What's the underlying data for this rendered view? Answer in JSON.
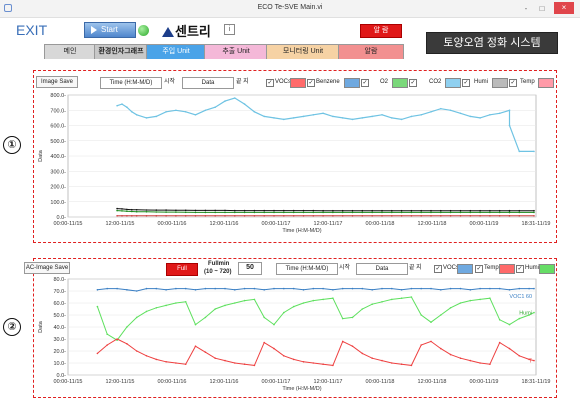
{
  "window": {
    "title": "ECO Te-SVE Main.vi",
    "minimize": "-",
    "maximize": "□",
    "close": "×"
  },
  "toolbar": {
    "exit_label": "EXIT",
    "start_label": "Start",
    "logo_text": "센트리",
    "info_icon": "i",
    "alarm_label": "알 람",
    "system_title": "토양오염 정화 시스템"
  },
  "tabs": [
    {
      "label": "메인",
      "color": "#d8d8d8"
    },
    {
      "label": "환경인자그래프",
      "color": "#c8c8c8"
    },
    {
      "label": "주입 Unit",
      "color": "#4aa3e8"
    },
    {
      "label": "추출 Unit",
      "color": "#f4b8d8"
    },
    {
      "label": "모니터링 Unit",
      "color": "#f6d2a4"
    },
    {
      "label": "알람",
      "color": "#f29090"
    }
  ],
  "panel1": {
    "marker": "①",
    "image_save_label": "Image Save",
    "time_format_value": "Time (H:M-M/D)",
    "start_kr": "시작",
    "data_value": "Data",
    "end_kr": "끝 지",
    "series": [
      {
        "name": "VOCs",
        "color": "#6fc3e3",
        "checked": true
      },
      {
        "name": "Benzene",
        "color": "#ff6a6a",
        "checked": true
      },
      {
        "name": "O2",
        "color": "#7ad87a",
        "checked": true
      },
      {
        "name": "CO2",
        "color": "#8fd0f0",
        "checked": true
      },
      {
        "name": "Humi",
        "color": "#222222",
        "checked": true
      },
      {
        "name": "Temp",
        "color": "#ff9aa8",
        "checked": true
      }
    ]
  },
  "panel2": {
    "marker": "②",
    "image_save_label": "AC-Image Save",
    "full_label": "Full",
    "fullmin_label": "Fullmin",
    "fullmin_range": "(10 ~ 720)",
    "fullmin_value": "50",
    "time_format_value": "Time (H:M-M/D)",
    "start_kr": "시작",
    "data_value": "Data",
    "end_kr": "끝 지",
    "series": [
      {
        "name": "VOCs",
        "color": "#3a7fc4",
        "checked": true
      },
      {
        "name": "Temp",
        "color": "#ff6a6a",
        "checked": true
      },
      {
        "name": "Humi",
        "color": "#66dd66",
        "checked": true
      }
    ],
    "trace_labels": [
      "VOC1 60",
      "Humi",
      "T"
    ]
  },
  "chart_data": [
    {
      "type": "line",
      "title": "",
      "xlabel": "Time (H:M-M/D)",
      "ylabel": "Data",
      "ylim": [
        0,
        800
      ],
      "yticks": [
        "800.0-",
        "700.0-",
        "600.0-",
        "500.0-",
        "400.0-",
        "300.0-",
        "200.0-",
        "100.0-",
        "0.0-"
      ],
      "xticks": [
        "00:00-11/15",
        "12:00-11/15",
        "00:00-11/16",
        "12:00-11/16",
        "00:00-11/17",
        "12:00-11/17",
        "00:00-11/18",
        "12:00-11/18",
        "00:00-11/19",
        "18:31-11/19"
      ],
      "x": [
        0.5,
        0.55,
        0.6,
        0.65,
        0.7,
        0.8,
        0.9,
        1.0,
        1.1,
        1.2,
        1.3,
        1.4,
        1.5,
        1.6,
        1.7,
        1.8,
        1.9,
        2.0,
        2.1,
        2.2,
        2.3,
        2.4,
        2.5,
        2.6,
        2.7,
        2.8,
        2.9,
        3.0,
        3.1,
        3.2,
        3.3,
        3.4,
        3.5,
        3.6,
        3.7,
        3.8,
        3.9,
        4.0,
        4.1,
        4.2,
        4.3,
        4.4,
        4.5,
        4.5,
        4.6,
        4.75
      ],
      "series": [
        {
          "name": "VOCs",
          "values": [
            730,
            740,
            720,
            690,
            670,
            650,
            660,
            690,
            700,
            690,
            670,
            700,
            720,
            760,
            780,
            740,
            690,
            660,
            650,
            640,
            650,
            660,
            670,
            680,
            660,
            650,
            640,
            650,
            660,
            670,
            650,
            640,
            660,
            670,
            690,
            710,
            700,
            680,
            660,
            650,
            670,
            680,
            700,
            600,
            430,
            430
          ]
        },
        {
          "name": "O2",
          "values": [
            42,
            40,
            38,
            36,
            35,
            34,
            33,
            32,
            32,
            31,
            30,
            30,
            30,
            30,
            30,
            30,
            30,
            30,
            30,
            30,
            30,
            30,
            30,
            30,
            30,
            30,
            30,
            30,
            30,
            30,
            30,
            30,
            30,
            30,
            30,
            30,
            30,
            30,
            30,
            30,
            30,
            30,
            30,
            30,
            30,
            30
          ]
        },
        {
          "name": "Humi",
          "values": [
            55,
            53,
            50,
            48,
            47,
            46,
            45,
            45,
            44,
            44,
            43,
            43,
            43,
            43,
            42,
            42,
            42,
            42,
            42,
            42,
            42,
            42,
            42,
            41,
            41,
            41,
            41,
            41,
            41,
            41,
            41,
            41,
            41,
            41,
            41,
            41,
            41,
            41,
            41,
            41,
            41,
            41,
            41,
            41,
            41,
            41
          ]
        },
        {
          "name": "Benzene",
          "values": [
            8,
            8,
            8,
            8,
            8,
            8,
            8,
            8,
            8,
            8,
            8,
            8,
            8,
            8,
            8,
            8,
            8,
            8,
            8,
            8,
            8,
            8,
            8,
            8,
            8,
            8,
            8,
            8,
            8,
            8,
            8,
            8,
            8,
            8,
            8,
            8,
            8,
            8,
            8,
            8,
            8,
            8,
            8,
            8,
            8,
            8
          ]
        }
      ]
    },
    {
      "type": "line",
      "title": "",
      "xlabel": "Time (H:M-M/D)",
      "ylabel": "Data",
      "ylim": [
        0,
        80
      ],
      "yticks": [
        "80.0-",
        "70.0-",
        "60.0-",
        "50.0-",
        "40.0-",
        "30.0-",
        "20.0-",
        "10.0-",
        "0.0-"
      ],
      "xticks": [
        "00:00-11/15",
        "12:00-11/15",
        "00:00-11/16",
        "12:00-11/16",
        "00:00-11/17",
        "12:00-11/17",
        "00:00-11/18",
        "12:00-11/18",
        "00:00-11/19",
        "18:31-11/19"
      ],
      "x": [
        0.3,
        0.4,
        0.5,
        0.6,
        0.7,
        0.8,
        0.9,
        1.0,
        1.1,
        1.2,
        1.3,
        1.4,
        1.5,
        1.6,
        1.7,
        1.8,
        1.9,
        2.0,
        2.1,
        2.2,
        2.3,
        2.4,
        2.5,
        2.6,
        2.7,
        2.8,
        2.9,
        3.0,
        3.1,
        3.2,
        3.3,
        3.4,
        3.5,
        3.6,
        3.7,
        3.8,
        3.9,
        4.0,
        4.1,
        4.2,
        4.3,
        4.4,
        4.5,
        4.6,
        4.7,
        4.75
      ],
      "series": [
        {
          "name": "VOCs",
          "values": [
            71,
            72,
            72,
            71,
            70,
            72,
            72,
            71,
            72,
            72,
            71,
            72,
            72,
            72,
            71,
            72,
            72,
            71,
            72,
            72,
            72,
            71,
            72,
            72,
            71,
            72,
            72,
            72,
            71,
            72,
            72,
            71,
            72,
            72,
            72,
            71,
            72,
            72,
            71,
            72,
            72,
            72,
            71,
            72,
            72,
            72
          ]
        },
        {
          "name": "Humi",
          "values": [
            57,
            34,
            29,
            40,
            48,
            53,
            56,
            58,
            60,
            61,
            42,
            48,
            55,
            58,
            60,
            62,
            63,
            48,
            42,
            52,
            57,
            60,
            62,
            63,
            64,
            47,
            48,
            55,
            59,
            61,
            63,
            64,
            65,
            50,
            44,
            50,
            56,
            60,
            62,
            63,
            64,
            46,
            42,
            47,
            50,
            52
          ]
        },
        {
          "name": "Temp",
          "values": [
            18,
            25,
            30,
            26,
            20,
            16,
            13,
            11,
            10,
            9,
            24,
            19,
            14,
            12,
            10,
            9,
            8,
            27,
            22,
            16,
            13,
            11,
            10,
            9,
            8,
            28,
            24,
            18,
            14,
            12,
            10,
            9,
            8,
            25,
            28,
            22,
            17,
            14,
            12,
            10,
            9,
            27,
            22,
            16,
            13,
            12
          ]
        }
      ]
    }
  ]
}
